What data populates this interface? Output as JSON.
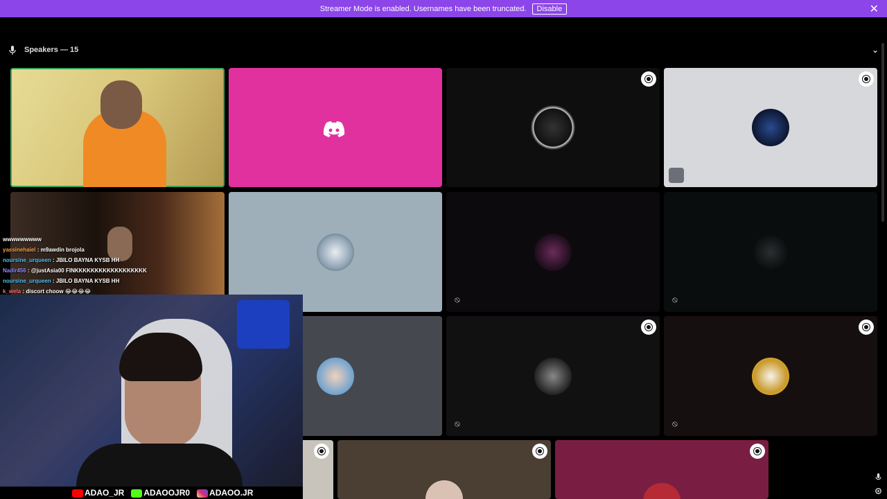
{
  "banner": {
    "message": "Streamer Mode is enabled. Usernames have been truncated.",
    "disable_label": "Disable",
    "close_glyph": "✕"
  },
  "section": {
    "title": "Speakers — 15",
    "icon": "microphone-icon",
    "collapse_glyph": "⌄"
  },
  "tiles": [
    {
      "name": "tile-webcam-streamer",
      "bg": "#d8c87a",
      "speaking": true
    },
    {
      "name": "tile-discord-default",
      "bg": "#e0319f",
      "icon": "discord-logo-icon"
    },
    {
      "name": "tile-spiderweb-avatar",
      "bg": "#0e0e0f",
      "badge": true
    },
    {
      "name": "tile-goodnight-avatar",
      "bg": "#d6d8db",
      "badge": true,
      "hidden_camera": true
    },
    {
      "name": "tile-webcam-sunglasses",
      "bg": "#2a1a12"
    },
    {
      "name": "tile-robot-avatar",
      "bg": "#9fafba",
      "muted": true
    },
    {
      "name": "tile-night-avatar",
      "bg": "#0c0a0c",
      "muted": true
    },
    {
      "name": "tile-mav-avatar",
      "bg": "#0a0d0d",
      "muted": true
    },
    {
      "name": "tile-boy-avatar",
      "bg": "#46484f",
      "muted": true
    },
    {
      "name": "tile-bw-avatar",
      "bg": "#111111",
      "badge": true,
      "muted": true
    },
    {
      "name": "tile-football-avatar",
      "bg": "#150f10",
      "badge": true,
      "muted": true
    },
    {
      "name": "tile-partial-left",
      "bg": "#c8c4bc",
      "badge": true
    },
    {
      "name": "tile-couple-avatar",
      "bg": "#4b3e33",
      "badge": true
    },
    {
      "name": "tile-maroon-avatar",
      "bg": "#7a1d42",
      "badge": true
    }
  ],
  "chat": {
    "lines": [
      {
        "user": "",
        "text": "wwwwwwwww"
      },
      {
        "user": "yassinehaiel",
        "text": ": m9awdin brojola"
      },
      {
        "user": "noursine_urqueen",
        "text": ": JBILO BAYNA KYSB HH"
      },
      {
        "user": "Nadir456",
        "text": ": @justAsia00 FINKKKKKKKKKKKKKKKKKK"
      },
      {
        "user": "noursine_urqueen",
        "text": ": JBILO BAYNA KYSB HH"
      },
      {
        "user": "k_wela",
        "text": ": discort choow 😂😂😂😂"
      }
    ]
  },
  "socials": {
    "youtube": "ADAO_JR",
    "kick": "ADAOOJR0",
    "instagram": "ADAOO.JR"
  },
  "colors": {
    "banner": "#8c45e8",
    "speaking_outline": "#3ba55c",
    "discord_pink": "#e0319f"
  }
}
